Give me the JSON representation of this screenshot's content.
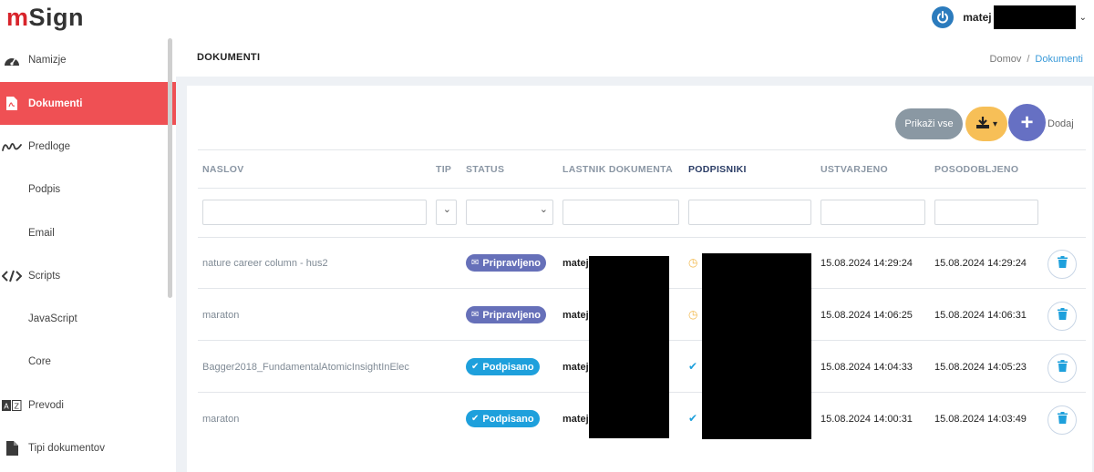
{
  "app": {
    "logo_m": "m",
    "logo_rest": "Sign"
  },
  "user": {
    "name": "matej",
    "power_icon": "power-icon",
    "caret": "⌄"
  },
  "sidebar": {
    "items": [
      {
        "label": "Namizje",
        "icon": "dashboard-icon",
        "active": false,
        "sub": false
      },
      {
        "label": "Dokumenti",
        "icon": "pdf-file-icon",
        "active": true,
        "sub": false
      },
      {
        "label": "Predloge",
        "icon": "signature-icon",
        "active": false,
        "sub": false
      },
      {
        "label": "Podpis",
        "icon": "",
        "active": false,
        "sub": true
      },
      {
        "label": "Email",
        "icon": "",
        "active": false,
        "sub": true
      },
      {
        "label": "Scripts",
        "icon": "code-icon",
        "active": false,
        "sub": false
      },
      {
        "label": "JavaScript",
        "icon": "",
        "active": false,
        "sub": true
      },
      {
        "label": "Core",
        "icon": "",
        "active": false,
        "sub": true
      },
      {
        "label": "Prevodi",
        "icon": "translate-icon",
        "active": false,
        "sub": false
      },
      {
        "label": "Tipi dokumentov",
        "icon": "file-icon",
        "active": false,
        "sub": false
      }
    ]
  },
  "page": {
    "title": "DOKUMENTI",
    "breadcrumb": {
      "home": "Domov",
      "separator": "/",
      "current": "Dokumenti"
    }
  },
  "toolbar": {
    "show_all": "Prikaži vse",
    "download_icon": "download-icon",
    "add_label": "Dodaj",
    "add_symbol": "+"
  },
  "table": {
    "headers": {
      "naslov": "NASLOV",
      "tip": "TIP",
      "status": "STATUS",
      "lastnik": "LASTNIK DOKUMENTA",
      "podpisniki": "PODPISNIKI",
      "ustvarjeno": "USTVARJENO",
      "posodobljeno": "POSODOBLJENO"
    },
    "rows": [
      {
        "title": "nature career column - hus2",
        "status": "Pripravljeno",
        "status_kind": "prep",
        "owner": "matej",
        "signer_icon": "clock-icon",
        "created": "15.08.2024 14:29:24",
        "updated": "15.08.2024 14:29:24"
      },
      {
        "title": "maraton",
        "status": "Pripravljeno",
        "status_kind": "prep",
        "owner": "matej",
        "signer_icon": "clock-icon",
        "created": "15.08.2024 14:06:25",
        "updated": "15.08.2024 14:06:31"
      },
      {
        "title": "Bagger2018_FundamentalAtomicInsightInElec",
        "status": "Podpisano",
        "status_kind": "sign",
        "owner": "matej",
        "signer_icon": "check-icon",
        "created": "15.08.2024 14:04:33",
        "updated": "15.08.2024 14:05:23"
      },
      {
        "title": "maraton",
        "status": "Podpisano",
        "status_kind": "sign",
        "owner": "matej",
        "signer_icon": "check-icon",
        "created": "15.08.2024 14:00:31",
        "updated": "15.08.2024 14:03:49"
      }
    ]
  },
  "colors": {
    "accent": "#ef5054",
    "prep": "#6670b9",
    "signed": "#1ea0dc",
    "add": "#6670c3",
    "download": "#f7bf57"
  }
}
